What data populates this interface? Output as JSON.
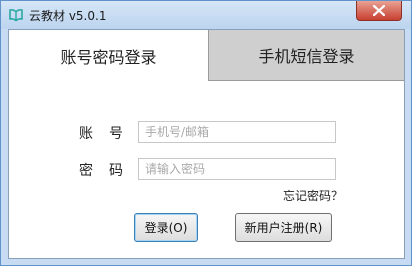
{
  "window": {
    "title": "云教材 v5.0.1",
    "icons": {
      "app": "book-icon",
      "close": "close-icon"
    }
  },
  "tabs": [
    {
      "label": "账号密码登录",
      "active": true
    },
    {
      "label": "手机短信登录",
      "active": false
    }
  ],
  "form": {
    "account_label": "账号",
    "account_placeholder": "手机号/邮箱",
    "account_value": "",
    "password_label": "密码",
    "password_placeholder": "请输入密码",
    "password_value": "",
    "forgot_link": "忘记密码？"
  },
  "buttons": {
    "login": "登录(O)",
    "register": "新用户注册(R)"
  },
  "colors": {
    "titlebar": "#c7dcf2",
    "close_button": "#c84031",
    "inactive_tab": "#cfcfcf",
    "app_icon": "#2aa8a0"
  }
}
